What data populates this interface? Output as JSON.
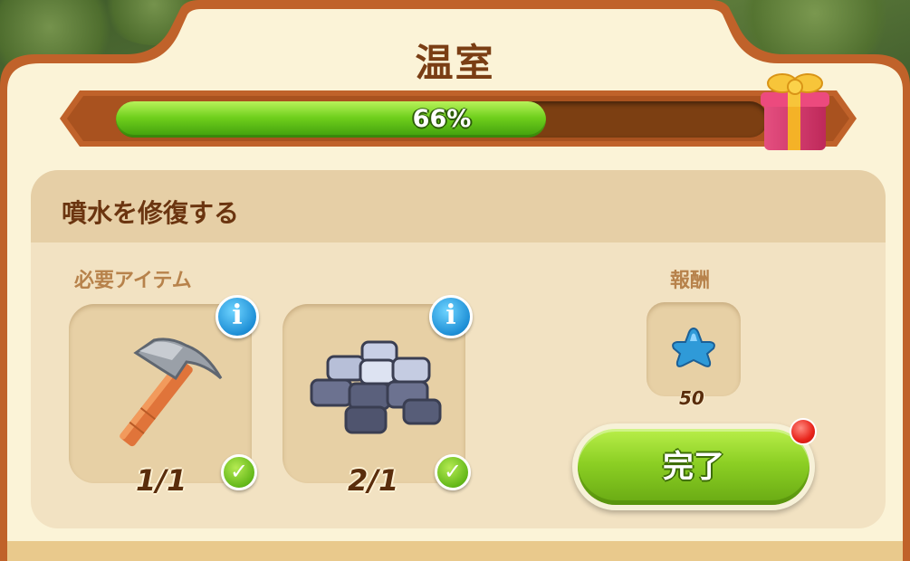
{
  "window": {
    "title": "温室"
  },
  "progress": {
    "percent": 66,
    "label": "66%",
    "reward_icon": "gift-box-icon"
  },
  "task": {
    "title": "噴水を修復する",
    "required_label": "必要アイテム",
    "reward_label": "報酬",
    "items": [
      {
        "icon": "hammer-icon",
        "count": "1/1",
        "status": "complete"
      },
      {
        "icon": "stone-blocks-icon",
        "count": "2/1",
        "status": "complete"
      }
    ],
    "reward": {
      "icon": "blue-star-icon",
      "amount": "50"
    },
    "complete_button": "完了"
  },
  "colors": {
    "frame_orange": "#c0622a",
    "panel_cream": "#fbf3d7",
    "title_brown": "#7a3e14",
    "progress_green": "#6fcf1c",
    "button_green": "#8ccf24",
    "info_blue": "#1e8fd6",
    "notification_red": "#e8231a"
  }
}
